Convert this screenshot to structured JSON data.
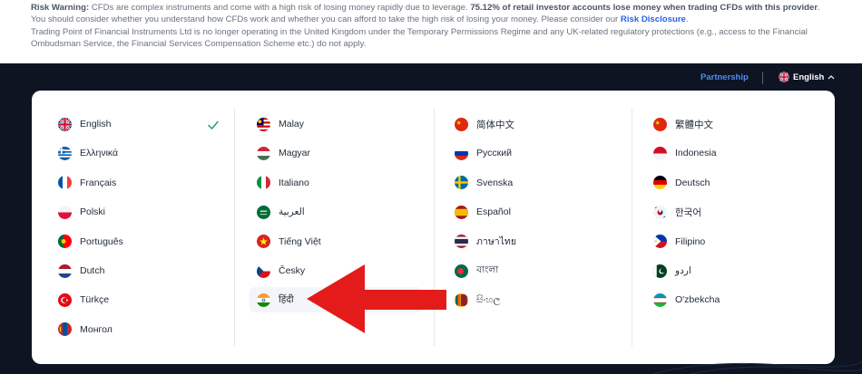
{
  "risk": {
    "label": "Risk Warning:",
    "text1": " CFDs are complex instruments and come with a high risk of losing money rapidly due to leverage. ",
    "bold": "75.12% of retail investor accounts lose money when trading CFDs with this provider",
    "text2": ". You should consider whether you understand how CFDs work and whether you can afford to take the high risk of losing your money. Please consider our ",
    "link": "Risk Disclosure",
    "text3": ".",
    "line2": "Trading Point of Financial Instruments Ltd is no longer operating in the United Kingdom under the Temporary Permissions Regime and any UK-related regulatory protections (e.g., access to the Financial Ombudsman Service, the Financial Services Compensation Scheme etc.) do not apply."
  },
  "header": {
    "partnership": "Partnership",
    "language": "English",
    "caret": "^"
  },
  "languages": {
    "col1": [
      {
        "label": "English",
        "flag": "gb",
        "selected": true
      },
      {
        "label": "Ελληνικά",
        "flag": "gr"
      },
      {
        "label": "Français",
        "flag": "fr"
      },
      {
        "label": "Polski",
        "flag": "pl"
      },
      {
        "label": "Português",
        "flag": "pt"
      },
      {
        "label": "Dutch",
        "flag": "nl"
      },
      {
        "label": "Türkçe",
        "flag": "tr"
      },
      {
        "label": "Монгол",
        "flag": "mn"
      }
    ],
    "col2": [
      {
        "label": "Malay",
        "flag": "my"
      },
      {
        "label": "Magyar",
        "flag": "hu"
      },
      {
        "label": "Italiano",
        "flag": "it"
      },
      {
        "label": "العربية",
        "flag": "sa"
      },
      {
        "label": "Tiếng Việt",
        "flag": "vn"
      },
      {
        "label": "Česky",
        "flag": "cz"
      },
      {
        "label": "हिंदी",
        "flag": "in",
        "highlighted": true
      }
    ],
    "col3": [
      {
        "label": "简体中文",
        "flag": "cn"
      },
      {
        "label": "Русский",
        "flag": "ru"
      },
      {
        "label": "Svenska",
        "flag": "se"
      },
      {
        "label": "Español",
        "flag": "es"
      },
      {
        "label": "ภาษาไทย",
        "flag": "th"
      },
      {
        "label": "বাংলা",
        "flag": "bd"
      },
      {
        "label": "සිංහල",
        "flag": "lk"
      }
    ],
    "col4": [
      {
        "label": "繁體中文",
        "flag": "cn"
      },
      {
        "label": "Indonesia",
        "flag": "id"
      },
      {
        "label": "Deutsch",
        "flag": "de"
      },
      {
        "label": "한국어",
        "flag": "kr"
      },
      {
        "label": "Filipino",
        "flag": "ph"
      },
      {
        "label": "اردو",
        "flag": "pk"
      },
      {
        "label": "O'zbekcha",
        "flag": "uz"
      }
    ]
  },
  "colors": {
    "accent": "#4f8cf7",
    "check": "#22a06b",
    "arrow": "#e31b1b",
    "dark_bg": "#0e1422"
  }
}
